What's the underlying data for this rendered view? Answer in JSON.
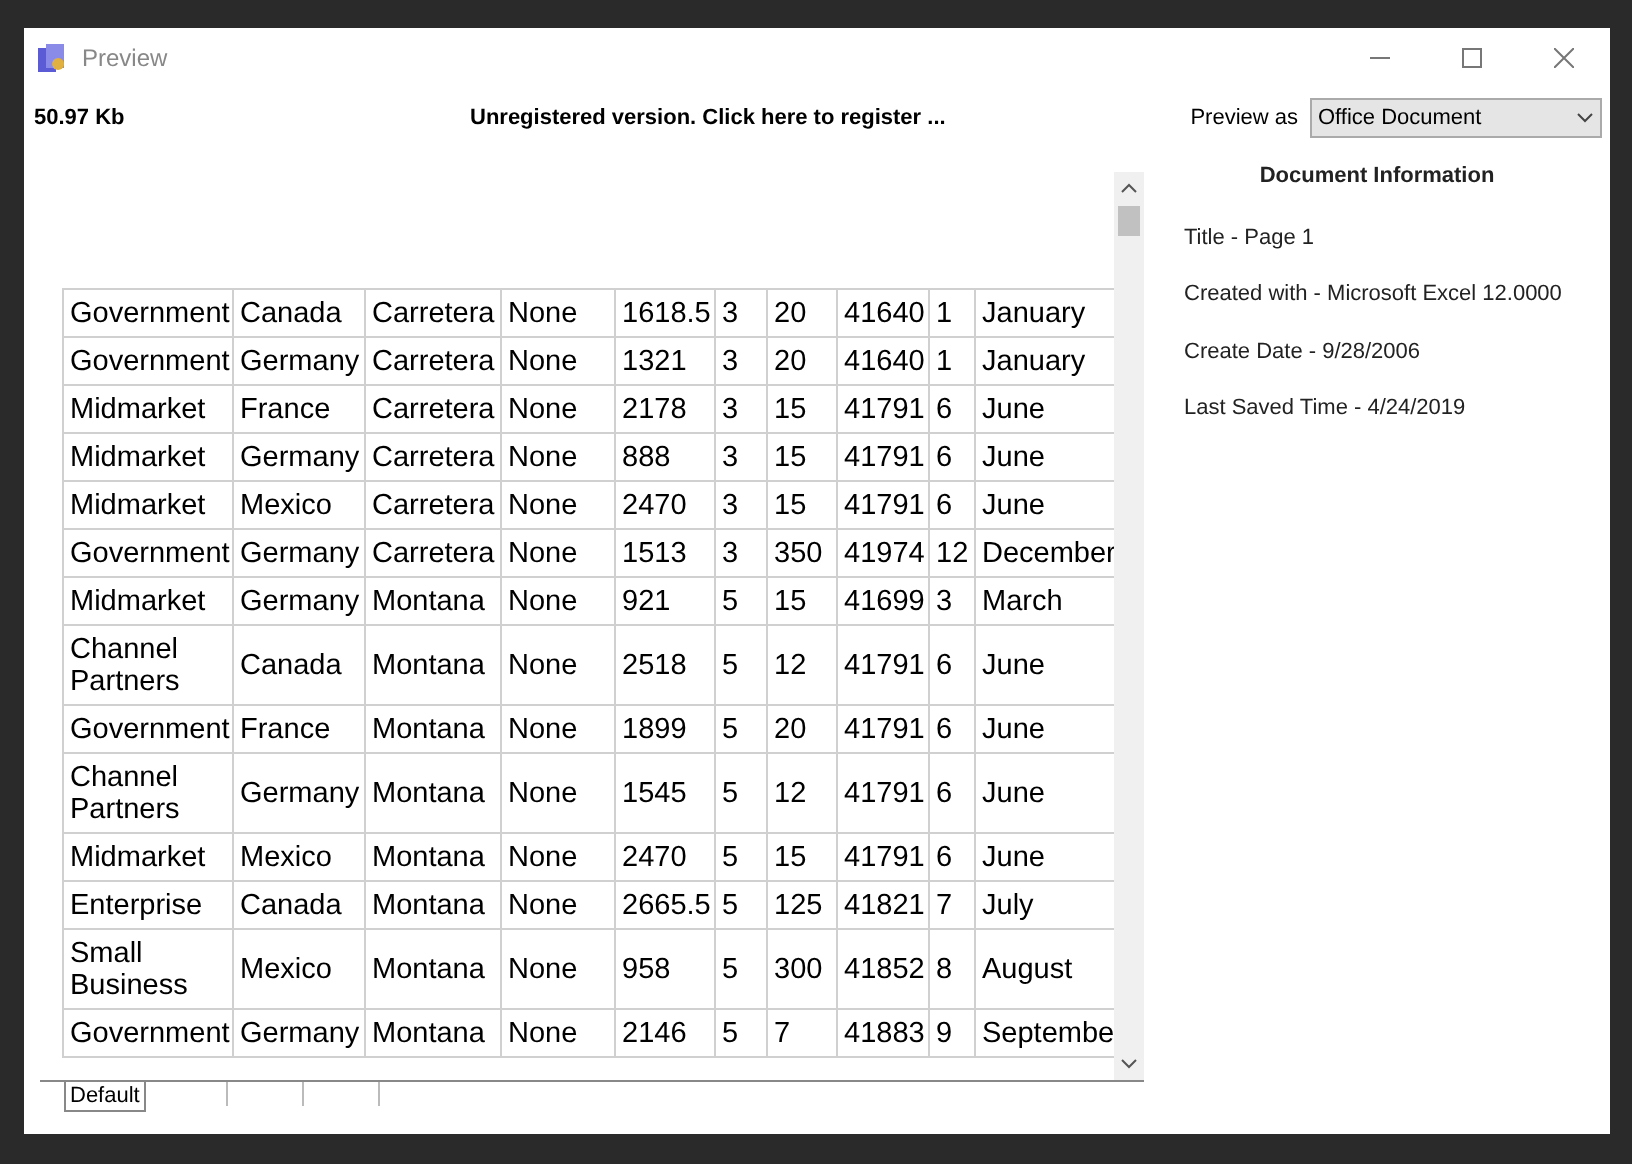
{
  "window": {
    "title": "Preview"
  },
  "toolbar": {
    "file_size": "50.97 Kb",
    "register_link": "Unregistered version. Click here to register ...",
    "preview_as_label": "Preview as",
    "preview_as_value": "Office Document"
  },
  "table": {
    "rows": [
      [
        "Government",
        "Canada",
        "Carretera",
        "None",
        "1618.5",
        "3",
        "20",
        "41640",
        "1",
        "January"
      ],
      [
        "Government",
        "Germany",
        "Carretera",
        "None",
        "1321",
        "3",
        "20",
        "41640",
        "1",
        "January"
      ],
      [
        "Midmarket",
        "France",
        "Carretera",
        "None",
        "2178",
        "3",
        "15",
        "41791",
        "6",
        "June"
      ],
      [
        "Midmarket",
        "Germany",
        "Carretera",
        "None",
        "888",
        "3",
        "15",
        "41791",
        "6",
        "June"
      ],
      [
        "Midmarket",
        "Mexico",
        "Carretera",
        "None",
        "2470",
        "3",
        "15",
        "41791",
        "6",
        "June"
      ],
      [
        "Government",
        "Germany",
        "Carretera",
        "None",
        "1513",
        "3",
        "350",
        "41974",
        "12",
        "December"
      ],
      [
        "Midmarket",
        "Germany",
        "Montana",
        "None",
        "921",
        "5",
        "15",
        "41699",
        "3",
        "March"
      ],
      [
        "Channel Partners",
        "Canada",
        "Montana",
        "None",
        "2518",
        "5",
        "12",
        "41791",
        "6",
        "June"
      ],
      [
        "Government",
        "France",
        "Montana",
        "None",
        "1899",
        "5",
        "20",
        "41791",
        "6",
        "June"
      ],
      [
        "Channel Partners",
        "Germany",
        "Montana",
        "None",
        "1545",
        "5",
        "12",
        "41791",
        "6",
        "June"
      ],
      [
        "Midmarket",
        "Mexico",
        "Montana",
        "None",
        "2470",
        "5",
        "15",
        "41791",
        "6",
        "June"
      ],
      [
        "Enterprise",
        "Canada",
        "Montana",
        "None",
        "2665.5",
        "5",
        "125",
        "41821",
        "7",
        "July"
      ],
      [
        "Small Business",
        "Mexico",
        "Montana",
        "None",
        "958",
        "5",
        "300",
        "41852",
        "8",
        "August"
      ],
      [
        "Government",
        "Germany",
        "Montana",
        "None",
        "2146",
        "5",
        "7",
        "41883",
        "9",
        "Septembe"
      ]
    ]
  },
  "sheet_tabs": [
    {
      "label": "Default",
      "selected": true
    }
  ],
  "document_information": {
    "heading": "Document Information",
    "lines": [
      "Title - Page 1",
      "Created with - Microsoft Excel 12.0000",
      "Create Date - 9/28/2006",
      "Last Saved Time - 4/24/2019"
    ]
  }
}
